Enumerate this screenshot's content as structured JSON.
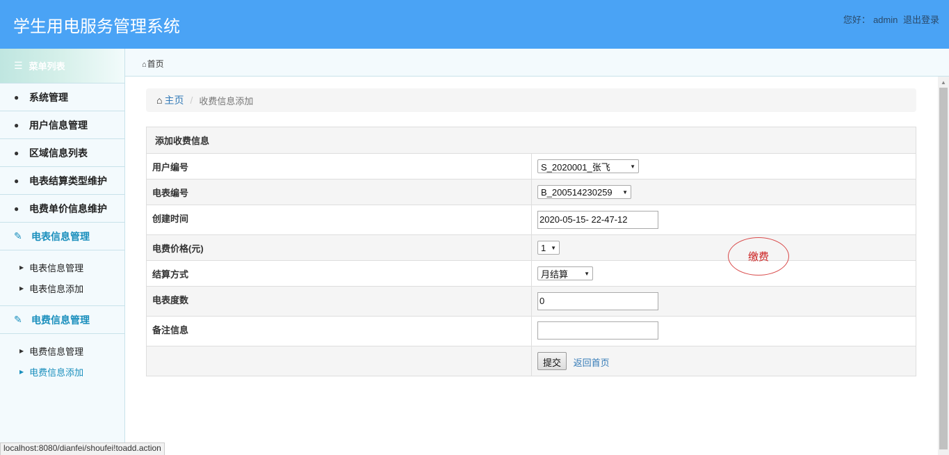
{
  "header": {
    "app_title": "学生用电服务管理系统",
    "greeting": "您好：",
    "username": "admin",
    "logout_label": "退出登录"
  },
  "sidebar": {
    "menu_title": "菜单列表",
    "items": [
      {
        "label": "系统管理",
        "icon": "user-icon"
      },
      {
        "label": "用户信息管理",
        "icon": "user-icon"
      },
      {
        "label": "区域信息列表",
        "icon": "user-icon"
      },
      {
        "label": "电表结算类型维护",
        "icon": "user-icon"
      },
      {
        "label": "电费单价信息维护",
        "icon": "user-icon"
      }
    ],
    "groups": [
      {
        "label": "电表信息管理",
        "icon": "edit-icon",
        "subitems": [
          "电表信息管理",
          "电表信息添加"
        ]
      },
      {
        "label": "电费信息管理",
        "icon": "edit-icon",
        "subitems": [
          "电费信息管理",
          "电费信息添加"
        ]
      }
    ],
    "active_subitem": "电费信息添加"
  },
  "tabbar": {
    "home_tab": "首页"
  },
  "breadcrumb": {
    "home": "主页",
    "current": "收费信息添加"
  },
  "form": {
    "caption": "添加收费信息",
    "user_id": {
      "label": "用户编号",
      "value": "S_2020001_张飞"
    },
    "meter_id": {
      "label": "电表编号",
      "value": "B_200514230259"
    },
    "created_time": {
      "label": "创建时间",
      "value": "2020-05-15- 22-47-12"
    },
    "price": {
      "label": "电费价格(元)",
      "value": "1"
    },
    "settlement": {
      "label": "结算方式",
      "value": "月结算"
    },
    "meter_reading": {
      "label": "电表度数",
      "value": "0"
    },
    "remarks": {
      "label": "备注信息",
      "value": ""
    },
    "submit_label": "提交",
    "back_label": "返回首页"
  },
  "annotation": {
    "text": "缴费",
    "color": "#d94b4b"
  },
  "statusbar": {
    "url": "localhost:8080/dianfei/shoufei!toadd.action"
  },
  "colors": {
    "header_bg": "#4aa3f5",
    "accent": "#1a8fbd",
    "link": "#337ab7"
  }
}
